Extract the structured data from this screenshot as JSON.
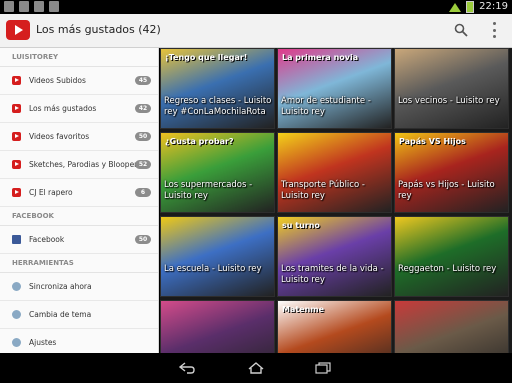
{
  "status": {
    "time": "22:19"
  },
  "actionbar": {
    "title": "Los más gustados (42)"
  },
  "sidebar": {
    "sections": [
      {
        "title": "LUISITOREY",
        "items": [
          {
            "label": "Videos Subidos",
            "count": "45",
            "icon": "youtube"
          },
          {
            "label": "Los más gustados",
            "count": "42",
            "icon": "youtube"
          },
          {
            "label": "Videos favoritos",
            "count": "50",
            "icon": "youtube"
          },
          {
            "label": "Sketches, Parodias y Bloopers",
            "count": "52",
            "icon": "youtube"
          },
          {
            "label": "CJ El rapero",
            "count": "6",
            "icon": "youtube"
          }
        ]
      },
      {
        "title": "FACEBOOK",
        "items": [
          {
            "label": "Facebook",
            "count": "50",
            "icon": "facebook"
          }
        ]
      },
      {
        "title": "HERRAMIENTAS",
        "items": [
          {
            "label": "Sincroniza ahora",
            "icon": "sync"
          },
          {
            "label": "Cambia de tema",
            "icon": "theme"
          },
          {
            "label": "Ajustes",
            "icon": "settings"
          }
        ]
      }
    ]
  },
  "videos": [
    {
      "caption": "Regreso a clases - Luisito rey #ConLaMochilaRota",
      "thumb_text": "¡Tengo que llegar!",
      "bg": "#3a6fb0",
      "accent": "#e8c33a"
    },
    {
      "caption": "Amor de estudiante - Luisito rey",
      "thumb_text": "La primera novia",
      "bg": "#7fb7d8",
      "accent": "#e03a8a"
    },
    {
      "caption": "Los vecinos - Luisito rey",
      "thumb_text": "",
      "bg": "#5a5a5a",
      "accent": "#c9a77a"
    },
    {
      "caption": "Los supermercados - Luisito rey",
      "thumb_text": "¿Gusta probar?",
      "bg": "#3a9e3a",
      "accent": "#f0c020"
    },
    {
      "caption": "Transporte Público - Luisito rey",
      "thumb_text": "",
      "bg": "#c0341f",
      "accent": "#f3d21a"
    },
    {
      "caption": "Papás vs Hijos - Luisito rey",
      "thumb_text": "Papás VS Hijos",
      "bg": "#a8241e",
      "accent": "#f2c515"
    },
    {
      "caption": "La escuela - Luisito rey",
      "thumb_text": "",
      "bg": "#3d6fc4",
      "accent": "#f0c915"
    },
    {
      "caption": "Los tramites de la vida - Luisito rey",
      "thumb_text": "su turno",
      "bg": "#6a3fa8",
      "accent": "#f3d020"
    },
    {
      "caption": "Reggaeton - Luisito rey",
      "thumb_text": "",
      "bg": "#1e6d28",
      "accent": "#f0c820"
    },
    {
      "caption": "",
      "thumb_text": "",
      "bg": "#5a2e6a",
      "accent": "#d44c8a"
    },
    {
      "caption": "",
      "thumb_text": "Matenme",
      "bg": "#b44a1e",
      "accent": "#ffffff"
    },
    {
      "caption": "",
      "thumb_text": "",
      "bg": "#6a5a48",
      "accent": "#c83a3a"
    }
  ]
}
